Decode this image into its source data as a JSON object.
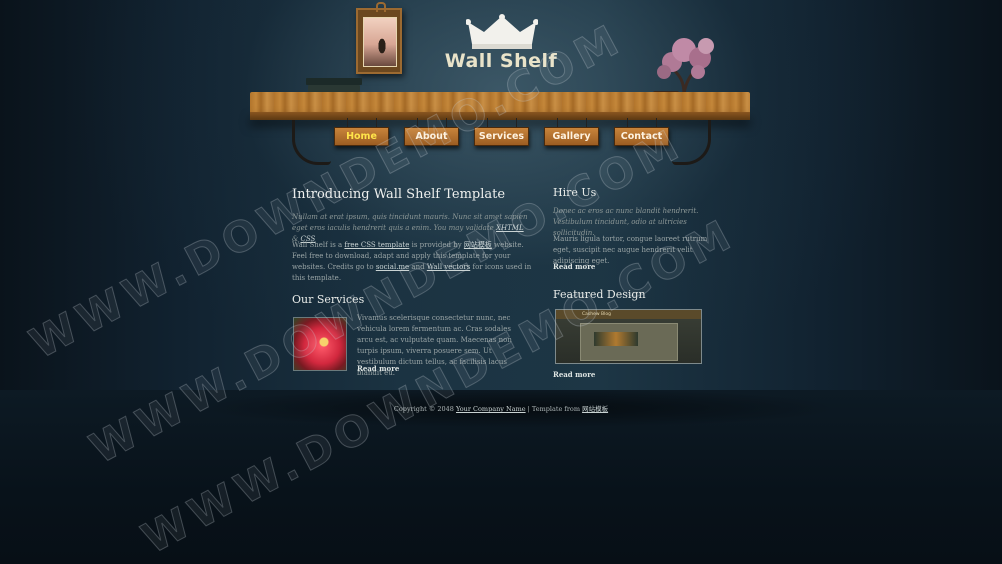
{
  "site": {
    "title": "Wall Shelf"
  },
  "nav": {
    "items": [
      {
        "label": "Home",
        "active": true
      },
      {
        "label": "About",
        "active": false
      },
      {
        "label": "Services",
        "active": false
      },
      {
        "label": "Gallery",
        "active": false
      },
      {
        "label": "Contact",
        "active": false
      }
    ]
  },
  "intro": {
    "heading": "Introducing Wall Shelf Template",
    "italic_text": "Nullam at erat ipsum, quis tincidunt mauris. Nunc sit amet sapien eget eros iaculis hendrerit quis a enim. You may validate",
    "italic_link_xhtml": "XHTML",
    "italic_amp": " & ",
    "italic_link_css": "CSS",
    "body_1": "Wall Shelf is a ",
    "link_free_css": "free CSS template",
    "body_2": " is provided by ",
    "link_provider": "网站模板",
    "body_3": " website. Feel free to download, adapt and apply this template for your websites. Credits go to ",
    "link_social": "social.me",
    "body_4": " and ",
    "link_wall": "Wall vectors",
    "body_5": " for icons used in this template."
  },
  "services": {
    "heading": "Our Services",
    "body": "Vivamus scelerisque consectetur nunc, nec vehicula lorem fermentum ac. Cras sodales arcu est, ac vulputate quam. Maecenas non turpis ipsum, viverra posuere sem. Ut vestibulum dictum tellus, ac facilisis lacus blandit eu.",
    "read_more": "Read more"
  },
  "hire": {
    "heading": "Hire Us",
    "italic_text": "Donec ac eros ac nunc blandit hendrerit. Vestibulum tincidunt, odio at ultricies sollicitudin.",
    "body": "Mauris ligula tortor, congue laoreet rutrum eget, suscipit nec augue hendrerit velit adipiscing eget.",
    "read_more": "Read more"
  },
  "featured": {
    "heading": "Featured Design",
    "thumb_title": "Cashew Blog",
    "read_more": "Read more"
  },
  "footer": {
    "prefix": "Copyright © 2048 ",
    "company_link": "Your Company Name",
    "middle": " | Template from ",
    "template_link": "网站模板"
  },
  "watermark": {
    "text": "WWW.DOWNDEMO.COM"
  },
  "colors": {
    "nav_active": "#ffe44a",
    "nav_text": "#fff3e0",
    "shelf_wood": "#b2752c",
    "background": "#0b1620"
  },
  "icons": [
    "crown-icon",
    "picture-frame",
    "bonsai-tree",
    "books"
  ]
}
